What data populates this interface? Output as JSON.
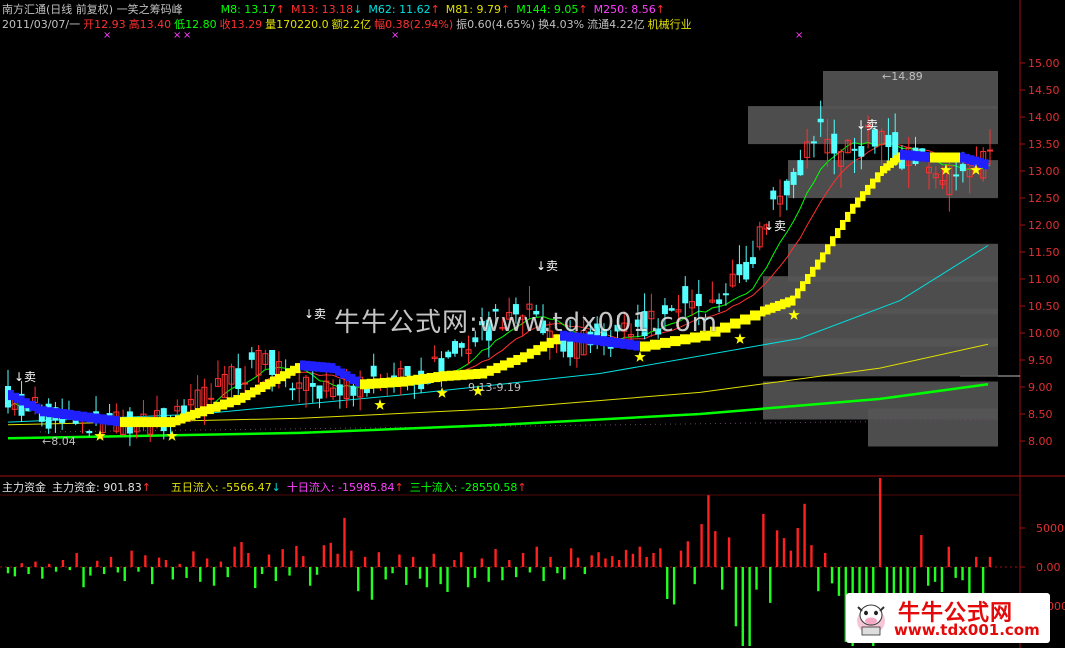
{
  "header": {
    "title": "南方汇通(日线 前复权) 一笑之筹码峰",
    "ma_values": [
      {
        "label": "M8: 13.17",
        "color": "#00ff00",
        "dir": "up"
      },
      {
        "label": "M13: 13.18",
        "color": "#ff3030",
        "dir": "down"
      },
      {
        "label": "M62: 11.62",
        "color": "#00e0e0",
        "dir": "up"
      },
      {
        "label": "M81: 9.79",
        "color": "#e0e000",
        "dir": "up"
      },
      {
        "label": "M144: 9.05",
        "color": "#00ff00",
        "dir": "up"
      },
      {
        "label": "M250: 8.56",
        "color": "#ff40ff",
        "dir": "up"
      }
    ],
    "quote": [
      {
        "label": "2011/03/07/一",
        "color": "#c0c0c0"
      },
      {
        "label": "开12.93",
        "color": "#ff3030"
      },
      {
        "label": "高13.40",
        "color": "#ff3030"
      },
      {
        "label": "低12.80",
        "color": "#00ff00"
      },
      {
        "label": "收13.29",
        "color": "#ff3030"
      },
      {
        "label": "量170220.0",
        "color": "#e0e000"
      },
      {
        "label": "额2.2亿",
        "color": "#e0e000"
      },
      {
        "label": "幅0.38(2.94%)",
        "color": "#ff3030"
      },
      {
        "label": "振0.60(4.65%)",
        "color": "#c0c0c0"
      },
      {
        "label": "换4.03%",
        "color": "#c0c0c0"
      },
      {
        "label": "流通4.22亿",
        "color": "#c0c0c0"
      },
      {
        "label": "机械行业",
        "color": "#e0e000"
      }
    ]
  },
  "subchart_header": {
    "name": "主力资金",
    "items": [
      {
        "label": "主力资金: 901.83",
        "color": "#e0e0e0",
        "dir": "up"
      },
      {
        "label": "五日流入: -5566.47",
        "color": "#e0e000",
        "dir": "down"
      },
      {
        "label": "十日流入: -15985.84",
        "color": "#ff40ff",
        "dir": "up"
      },
      {
        "label": "三十流入: -28550.58",
        "color": "#00ff00",
        "dir": "up"
      }
    ]
  },
  "watermark": "牛牛公式网:www.tdx001.com",
  "footer_logo": {
    "title": "牛牛公式网",
    "url": "www.tdx001.com"
  },
  "annotations": {
    "sell_label": "↓卖",
    "low_label": "←8.04",
    "high_label": "←14.89",
    "range_label": "9.13-9.19"
  },
  "colors": {
    "up_candle": "#ff3030",
    "down_candle": "#54ffff",
    "ma8": "#00ff00",
    "ma13": "#ff3030",
    "ma62": "#00e0e0",
    "ma81": "#e0e000",
    "ma144": "#00ff00",
    "ribbon_yellow": "#ffff00",
    "ribbon_blue": "#2020ff",
    "star": "#ffff00",
    "chip_bar": "#555555"
  },
  "chart_data": [
    {
      "type": "candlestick",
      "title": "南方汇通(日线 前复权) 一笑之筹码峰",
      "ylim": [
        7.8,
        15.25
      ],
      "y_ticks": [
        "15.00",
        "14.50",
        "14.00",
        "13.50",
        "13.00",
        "12.50",
        "12.00",
        "11.50",
        "11.00",
        "10.50",
        "10.00",
        "9.50",
        "9.00",
        "8.50",
        "8.00"
      ],
      "grid": false,
      "low_marker": 8.04,
      "high_marker": 14.89,
      "range_marker": [
        9.13,
        9.19
      ],
      "chip_peaks": [
        {
          "price": 14.5,
          "width": 0.35
        },
        {
          "price": 13.85,
          "width": 0.5
        },
        {
          "price": 12.85,
          "width": 0.42
        },
        {
          "price": 11.3,
          "width": 0.42
        },
        {
          "price": 10.7,
          "width": 0.47
        },
        {
          "price": 10.1,
          "width": 0.47
        },
        {
          "price": 9.55,
          "width": 0.47
        },
        {
          "price": 8.75,
          "width": 0.47
        },
        {
          "price": 8.25,
          "width": 0.26
        }
      ]
    },
    {
      "type": "bar",
      "title": "主力资金",
      "ylim": [
        -13000,
        13000
      ],
      "y_ticks": [
        "5000",
        "0.00",
        "-5000"
      ],
      "values": [
        -800,
        -1200,
        500,
        -900,
        700,
        -1500,
        400,
        -600,
        900,
        -400,
        1800,
        -2600,
        -1100,
        800,
        -900,
        1300,
        -700,
        -1800,
        2100,
        -600,
        1500,
        -2200,
        1200,
        900,
        -1600,
        400,
        -1400,
        2000,
        -1900,
        1100,
        -2400,
        700,
        -1300,
        2600,
        3200,
        1800,
        -2700,
        -900,
        1600,
        -1800,
        2300,
        -1100,
        2700,
        1400,
        -2400,
        -1000,
        2800,
        3100,
        1700,
        6300,
        2100,
        -3100,
        1300,
        -4200,
        1900,
        -1600,
        -800,
        1600,
        -2300,
        1300,
        -1500,
        -2600,
        1700,
        -2200,
        -3200,
        900,
        1900,
        -2600,
        -1400,
        1100,
        -1900,
        2300,
        -1700,
        900,
        -1300,
        1800,
        -700,
        2600,
        -1800,
        1300,
        -800,
        -1600,
        2400,
        1200,
        -900,
        1500,
        1900,
        1100,
        1400,
        900,
        2200,
        1700,
        2600,
        1300,
        1800,
        2400,
        -4100,
        -4800,
        2100,
        3300,
        -2200,
        5500,
        9200,
        4600,
        -2900,
        3800,
        -7600,
        -13900,
        -11800,
        -2900,
        6800,
        -4600,
        4700,
        3700,
        2100,
        5000,
        8100,
        2800,
        -3100,
        1800,
        -2100,
        -3700,
        -9600,
        -12100,
        -9400,
        -7100,
        -10200,
        11800,
        -5100,
        -9100,
        -6800,
        -4600,
        -5900,
        4100,
        -2400,
        -1900,
        -3200,
        2600,
        -1400,
        -1700,
        -4200,
        1300,
        -5500,
        1300
      ]
    }
  ]
}
